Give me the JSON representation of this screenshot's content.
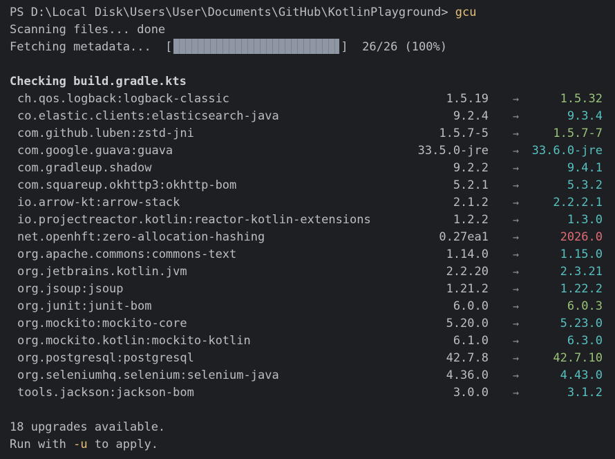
{
  "terminal": {
    "prompt": "PS D:\\Local Disk\\Users\\User\\Documents\\GitHub\\KotlinPlayground> ",
    "command": "gcu",
    "scanning": "Scanning files... done",
    "fetching_label": "Fetching metadata...  ",
    "progress_open": "[",
    "progress_close": "]",
    "progress_text": "  26/26 (100%)",
    "progress_fraction": 1.0,
    "checking_header": "Checking build.gradle.kts",
    "arrow_glyph": "→",
    "summary": "18 upgrades available.",
    "apply_prefix": "Run with ",
    "apply_flag": "-u",
    "apply_suffix": " to apply."
  },
  "colors": {
    "background": "#1e1f22",
    "text": "#bcbec4",
    "accent_yellow": "#e5c07b",
    "green": "#98c379",
    "cyan": "#56c1c0",
    "red": "#e06c75"
  },
  "dependencies": [
    {
      "name": "ch.qos.logback:logback-classic",
      "current": "1.5.19",
      "latest": "1.5.32",
      "color": "green"
    },
    {
      "name": "co.elastic.clients:elasticsearch-java",
      "current": "9.2.4",
      "latest": "9.3.4",
      "color": "cyan"
    },
    {
      "name": "com.github.luben:zstd-jni",
      "current": "1.5.7-5",
      "latest": "1.5.7-7",
      "color": "green"
    },
    {
      "name": "com.google.guava:guava",
      "current": "33.5.0-jre",
      "latest": "33.6.0-jre",
      "color": "cyan"
    },
    {
      "name": "com.gradleup.shadow",
      "current": "9.2.2",
      "latest": "9.4.1",
      "color": "cyan"
    },
    {
      "name": "com.squareup.okhttp3:okhttp-bom",
      "current": "5.2.1",
      "latest": "5.3.2",
      "color": "cyan"
    },
    {
      "name": "io.arrow-kt:arrow-stack",
      "current": "2.1.2",
      "latest": "2.2.2.1",
      "color": "cyan"
    },
    {
      "name": "io.projectreactor.kotlin:reactor-kotlin-extensions",
      "current": "1.2.2",
      "latest": "1.3.0",
      "color": "cyan"
    },
    {
      "name": "net.openhft:zero-allocation-hashing",
      "current": "0.27ea1",
      "latest": "2026.0",
      "color": "red"
    },
    {
      "name": "org.apache.commons:commons-text",
      "current": "1.14.0",
      "latest": "1.15.0",
      "color": "cyan"
    },
    {
      "name": "org.jetbrains.kotlin.jvm",
      "current": "2.2.20",
      "latest": "2.3.21",
      "color": "cyan"
    },
    {
      "name": "org.jsoup:jsoup",
      "current": "1.21.2",
      "latest": "1.22.2",
      "color": "cyan"
    },
    {
      "name": "org.junit:junit-bom",
      "current": "6.0.0",
      "latest": "6.0.3",
      "color": "green"
    },
    {
      "name": "org.mockito:mockito-core",
      "current": "5.20.0",
      "latest": "5.23.0",
      "color": "cyan"
    },
    {
      "name": "org.mockito.kotlin:mockito-kotlin",
      "current": "6.1.0",
      "latest": "6.3.0",
      "color": "cyan"
    },
    {
      "name": "org.postgresql:postgresql",
      "current": "42.7.8",
      "latest": "42.7.10",
      "color": "green"
    },
    {
      "name": "org.seleniumhq.selenium:selenium-java",
      "current": "4.36.0",
      "latest": "4.43.0",
      "color": "cyan"
    },
    {
      "name": "tools.jackson:jackson-bom",
      "current": "3.0.0",
      "latest": "3.1.2",
      "color": "cyan"
    }
  ]
}
